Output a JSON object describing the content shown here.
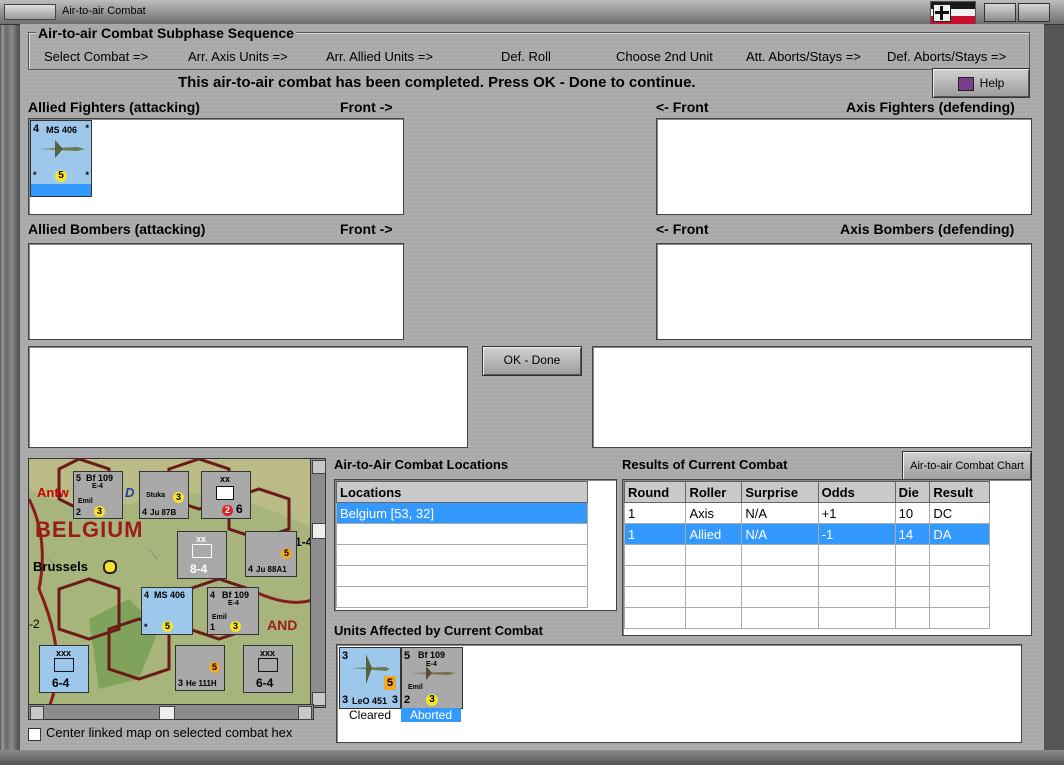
{
  "window": {
    "title": "Air-to-air Combat"
  },
  "sequence": {
    "group_title": "Air-to-air Combat Subphase Sequence",
    "steps": [
      "Select Combat =>",
      "Arr. Axis Units =>",
      "Arr. Allied Units =>",
      "Def. Roll",
      "Choose 2nd Unit",
      "Att. Aborts/Stays =>",
      "Def. Aborts/Stays =>"
    ]
  },
  "status_message": "This air-to-air combat has been completed.  Press OK - Done to continue.",
  "help_button": "Help",
  "allied_fighters": {
    "label": "Allied Fighters (attacking)",
    "front": "Front ->"
  },
  "axis_fighters": {
    "label": "Axis Fighters (defending)",
    "front": "<- Front"
  },
  "allied_bombers": {
    "label": "Allied Bombers (attacking)",
    "front": "Front ->"
  },
  "axis_bombers": {
    "label": "Axis Bombers (defending)",
    "front": "<- Front"
  },
  "allied_fighter_counter": {
    "top_left": "4",
    "name": "MS 406",
    "corner_tr": "*",
    "corner_bl": "*",
    "corner_br": "*",
    "value": "5"
  },
  "ok_button": "OK - Done",
  "locations": {
    "title": "Air-to-Air Combat Locations",
    "header": "Locations",
    "rows": [
      "Belgium [53, 32]",
      "",
      "",
      "",
      ""
    ]
  },
  "results": {
    "title": "Results of Current Combat",
    "chart_button": "Air-to-air Combat Chart",
    "headers": [
      "Round",
      "Roller",
      "Surprise",
      "Odds",
      "Die",
      "Result"
    ],
    "rows": [
      [
        "1",
        "Axis",
        "N/A",
        "+1",
        "10",
        "DC"
      ],
      [
        "1",
        "Allied",
        "N/A",
        "-1",
        "14",
        "DA"
      ],
      [
        "",
        "",
        "",
        "",
        "",
        ""
      ],
      [
        "",
        "",
        "",
        "",
        "",
        ""
      ],
      [
        "",
        "",
        "",
        "",
        "",
        ""
      ],
      [
        "",
        "",
        "",
        "",
        "",
        ""
      ]
    ]
  },
  "affected": {
    "title": "Units Affected by Current Combat",
    "unit1": {
      "top_left": "3",
      "name": "LeO 451",
      "bl": "3",
      "br": "3",
      "value": "5",
      "status": "Cleared"
    },
    "unit2": {
      "top_left": "5",
      "name": "Bf 109",
      "sub": "E-4",
      "tag": "Emil",
      "bl": "2",
      "value": "3",
      "status": "Aborted"
    }
  },
  "map": {
    "labels": {
      "country": "BELGIUM",
      "city": "Brussels",
      "antw": "Antw",
      "and": "AND",
      "d": "D"
    },
    "units": [
      {
        "name": "Bf 109",
        "sub": "E-4",
        "tag": "Emil",
        "tl": "5",
        "bl": "2",
        "v": "3"
      },
      {
        "name": "Ju 87B",
        "sub": "Stuka",
        "tl": "",
        "bl": "4",
        "v": "3"
      },
      {
        "name": "xx",
        "sub": "",
        "tl": "",
        "bl": "",
        "v": "2",
        "extra": "6"
      },
      {
        "name": "xx",
        "sub": "",
        "tl": "",
        "bl": "",
        "v": "8-4"
      },
      {
        "name": "Ju 88A1",
        "sub": "",
        "tl": "",
        "bl": "4",
        "v": "5"
      },
      {
        "name": "MS 406",
        "sub": "",
        "tl": "4",
        "bl": "*",
        "v": "5"
      },
      {
        "name": "Bf 109",
        "sub": "E-4",
        "tag": "Emil",
        "tl": "4",
        "bl": "1",
        "v": "3"
      },
      {
        "name": "xxx",
        "sub": "",
        "tl": "",
        "bl": "",
        "v": "6-4"
      },
      {
        "name": "He 111H",
        "sub": "",
        "tl": "",
        "bl": "3",
        "v": "5"
      },
      {
        "name": "xxx",
        "sub": "",
        "tl": "",
        "bl": "",
        "v": "6-4"
      }
    ],
    "misc": {
      "one_four": "1-4",
      "two": "-2"
    }
  },
  "center_map_checkbox": "Center linked map on selected combat hex"
}
